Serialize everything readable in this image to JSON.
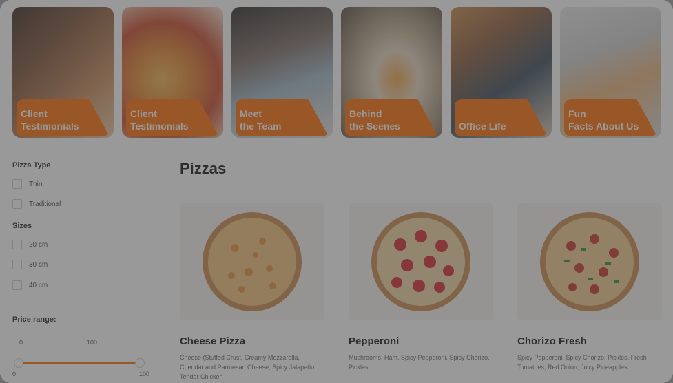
{
  "stories": [
    {
      "caption": "Client\nTestimonials"
    },
    {
      "caption": "Client\nTestimonials"
    },
    {
      "caption": "Meet\nthe Team"
    },
    {
      "caption": "Behind\nthe Scenes"
    },
    {
      "caption": "Office Life"
    },
    {
      "caption": "Fun\nFacts About Us"
    }
  ],
  "filters": {
    "pizza_type": {
      "title": "Pizza Type",
      "options": [
        "Thin",
        "Traditional"
      ]
    },
    "sizes": {
      "title": "Sizes",
      "options": [
        "20 cm",
        "30 cm",
        "40 cm"
      ]
    },
    "price": {
      "title": "Price range:",
      "from": "0",
      "to": "100",
      "min_label": "0",
      "max_label": "100"
    }
  },
  "main": {
    "title": "Pizzas",
    "products": [
      {
        "name": "Cheese Pizza",
        "description": "Cheese (Stuffed Crust, Creamy Mozzarella, Cheddar and Parmesan Cheese, Spicy Jalapeño, Tender Chicken"
      },
      {
        "name": "Pepperoni",
        "description": "Mushrooms, Ham, Spicy Pepperoni, Spicy Chorizo, Pickles"
      },
      {
        "name": "Chorizo Fresh",
        "description": "Spicy Pepperoni, Spicy Chorizo, Pickles, Fresh Tomatoes, Red Onion, Juicy Pineapples"
      }
    ]
  },
  "colors": {
    "accent": "#ff6a00"
  }
}
